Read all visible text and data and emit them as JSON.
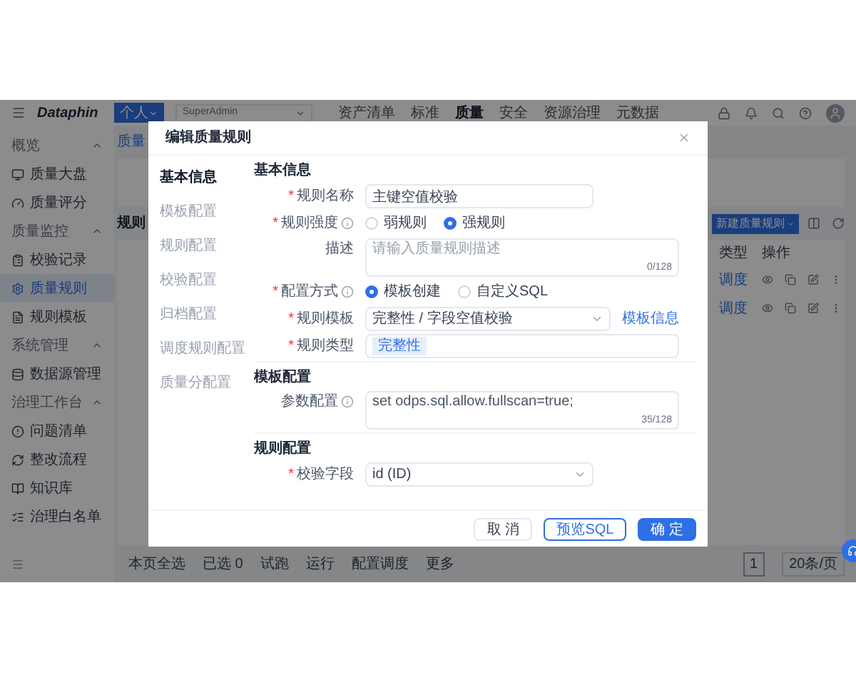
{
  "header": {
    "product": "Dataphin",
    "workspace": "个人",
    "project": "SuperAdmin",
    "nav": [
      {
        "label": "资产清单",
        "selected": false
      },
      {
        "label": "标准",
        "selected": false
      },
      {
        "label": "质量",
        "selected": true
      },
      {
        "label": "安全",
        "selected": false
      },
      {
        "label": "资源治理",
        "selected": false
      },
      {
        "label": "元数据",
        "selected": false
      }
    ]
  },
  "sidebar": {
    "groups": [
      {
        "title": "概览",
        "expanded": true,
        "items": [
          {
            "label": "质量大盘",
            "selected": false
          },
          {
            "label": "质量评分",
            "selected": false
          }
        ]
      },
      {
        "title": "质量监控",
        "expanded": true,
        "items": [
          {
            "label": "校验记录",
            "selected": false
          },
          {
            "label": "质量规则",
            "selected": true
          },
          {
            "label": "规则模板",
            "selected": false
          }
        ]
      },
      {
        "title": "系统管理",
        "expanded": true,
        "items": [
          {
            "label": "数据源管理",
            "selected": false
          }
        ]
      },
      {
        "title": "治理工作台",
        "expanded": true,
        "items": [
          {
            "label": "问题清单",
            "selected": false
          },
          {
            "label": "整改流程",
            "selected": false
          },
          {
            "label": "知识库",
            "selected": false
          },
          {
            "label": "治理白名单",
            "selected": false
          }
        ]
      }
    ]
  },
  "content": {
    "breadcrumb": "质量",
    "tab": "规则",
    "create_button": "新建质量规则",
    "columns": [
      "类型",
      "操作"
    ],
    "rows": [
      {
        "type": "调度"
      },
      {
        "type": "调度"
      }
    ],
    "footer": {
      "select_all": "本页全选",
      "selected": "已选 0",
      "actions": [
        "试跑",
        "运行",
        "配置调度",
        "更多"
      ]
    },
    "pagination": {
      "page": "1",
      "size": "20条/页"
    }
  },
  "dialog": {
    "title": "编辑质量规则",
    "nav": [
      {
        "label": "基本信息",
        "selected": true
      },
      {
        "label": "模板配置",
        "selected": false
      },
      {
        "label": "规则配置",
        "selected": false
      },
      {
        "label": "校验配置",
        "selected": false
      },
      {
        "label": "归档配置",
        "selected": false
      },
      {
        "label": "调度规则配置",
        "selected": false
      },
      {
        "label": "质量分配置",
        "selected": false
      }
    ],
    "sections": [
      {
        "title": "基本信息",
        "fields": [
          {
            "kind": "input",
            "mark": "*",
            "label": "规则名称",
            "value": "主键空值校验"
          },
          {
            "kind": "radio",
            "mark": "*",
            "label": "规则强度",
            "info": true,
            "options": [
              {
                "label": "弱规则",
                "selected": false
              },
              {
                "label": "强规则",
                "selected": true
              }
            ]
          },
          {
            "kind": "textarea",
            "label": "描述",
            "placeholder": "请输入质量规则描述",
            "count": "0/128"
          },
          {
            "kind": "radio",
            "mark": "*",
            "label": "配置方式",
            "info": true,
            "options": [
              {
                "label": "模板创建",
                "selected": true
              },
              {
                "label": "自定义SQL",
                "selected": false
              }
            ]
          },
          {
            "kind": "select",
            "mark": "*",
            "label": "规则模板",
            "value": "完整性 / 字段空值校验",
            "link": "模板信息"
          },
          {
            "kind": "tags",
            "mark": "*",
            "label": "规则类型",
            "tags": [
              "完整性"
            ]
          }
        ]
      },
      {
        "title": "模板配置",
        "fields": [
          {
            "kind": "textarea",
            "label": "参数配置",
            "info": true,
            "value": "set odps.sql.allow.fullscan=true;",
            "count": "35/128"
          }
        ]
      },
      {
        "title": "规则配置",
        "fields": [
          {
            "kind": "select",
            "mark": "*",
            "label": "校验字段",
            "value": "id (ID)",
            "narrow": true
          }
        ]
      }
    ],
    "buttons": [
      {
        "label": "取 消",
        "kind": "default"
      },
      {
        "label": "预览SQL",
        "kind": "outline"
      },
      {
        "label": "确 定",
        "kind": "primary"
      }
    ]
  }
}
